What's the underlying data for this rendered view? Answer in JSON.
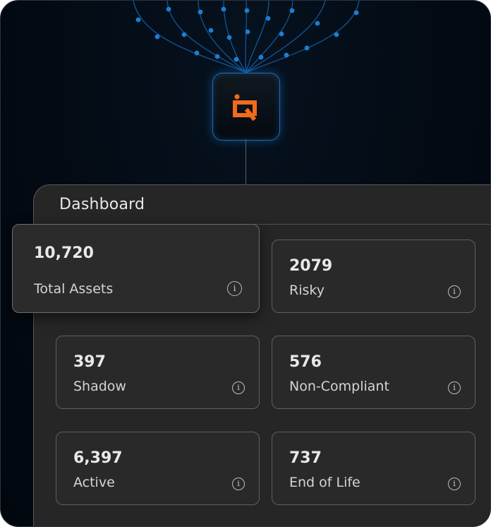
{
  "dashboard": {
    "title": "Dashboard"
  },
  "cards": [
    {
      "value": "10,720",
      "label": "Total Assets",
      "info": "i"
    },
    {
      "value": "2079",
      "label": "Risky",
      "info": "i"
    },
    {
      "value": "397",
      "label": "Shadow",
      "info": "i"
    },
    {
      "value": "576",
      "label": "Non-Compliant",
      "info": "i"
    },
    {
      "value": "6,397",
      "label": "Active",
      "info": "i"
    },
    {
      "value": "737",
      "label": "End of Life",
      "info": "i"
    }
  ],
  "colors": {
    "accent_orange": "#f26a1b",
    "network_blue": "#1a7fd4",
    "panel_bg": "#262626"
  },
  "icons": {
    "logo": "brand-logo-icon",
    "info": "info-icon"
  }
}
